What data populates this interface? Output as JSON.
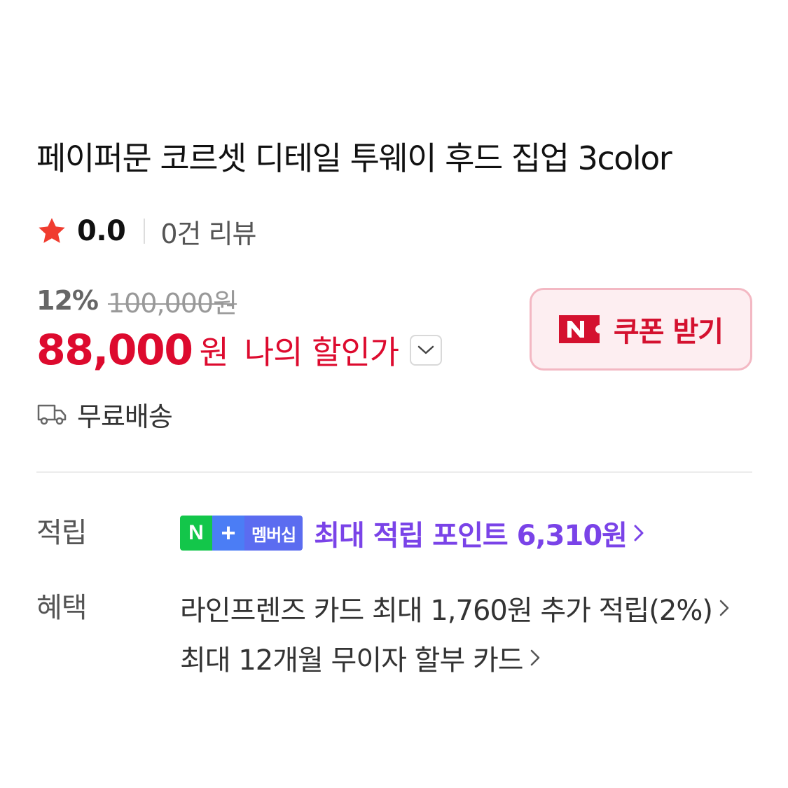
{
  "product": {
    "title": "페이퍼문 코르셋 디테일 투웨이 후드 집업 3color"
  },
  "rating": {
    "value": "0.0",
    "review_count": "0건 리뷰",
    "star_color": "#f03c2f"
  },
  "price": {
    "discount_rate": "12%",
    "original_price": "100,000원",
    "sale_price": "88,000",
    "unit": "원",
    "my_discount_label": "나의 할인가",
    "accent_color": "#dd0a2e"
  },
  "coupon": {
    "label": "쿠폰 받기",
    "icon": "naver-coupon-icon"
  },
  "shipping": {
    "label": "무료배송",
    "icon": "truck-icon"
  },
  "points": {
    "row_label": "적립",
    "badge_n": "N",
    "badge_plus": "+",
    "badge_text": "멤버십",
    "text": "최대 적립 포인트 6,310원",
    "accent_color": "#7a43e8"
  },
  "benefits": {
    "row_label": "혜택",
    "items": [
      {
        "text": "라인프렌즈 카드 최대 1,760원 추가 적립(2%)"
      },
      {
        "text": "최대 12개월 무이자 할부 카드"
      }
    ]
  }
}
